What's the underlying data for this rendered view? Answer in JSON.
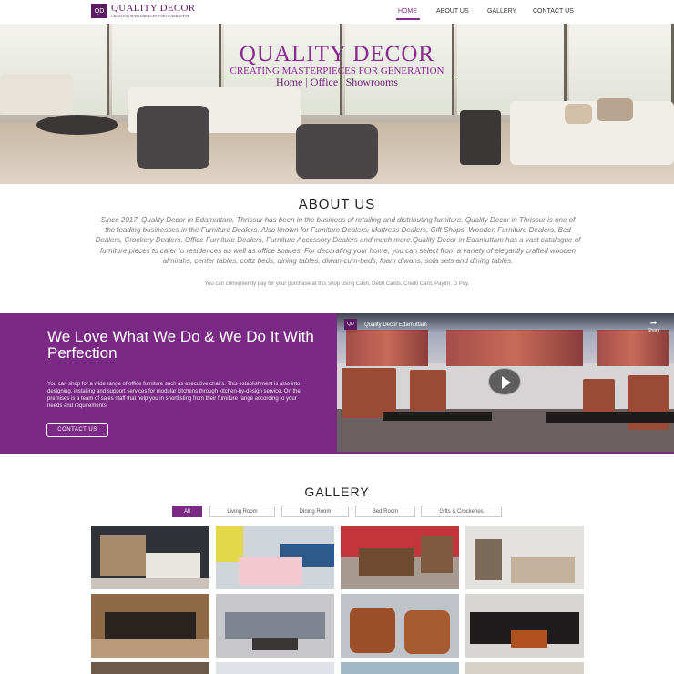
{
  "header": {
    "logo_mark": "QD",
    "logo_name": "QUALITY DECOR",
    "logo_tagline": "CREATING MASTERPIECES FOR GENERATION",
    "nav": [
      "HOME",
      "ABOUT US",
      "GALLERY",
      "CONTACT US"
    ]
  },
  "hero": {
    "title": "QUALITY DECOR",
    "subtitle": "CREATING MASTERPIECES FOR GENERATION",
    "links": "Home | Office | Showrooms"
  },
  "about": {
    "title": "ABOUT US",
    "body": "Since 2017, Quality Decor in Edamuttam, Thrissur has been in the business of retailing and distributing furniture. Quality Decor in Thrissur is one of the leading businesses in the Furniture Dealers. Also known for Furniture Dealers, Mattress Dealers, Gift Shops, Wooden Furniture Dealers, Bed Dealers, Crockery Dealers, Office Furniture Dealers, Furniture Accessory Dealers and much more.Quality Decor in Edamuttam has a vast catalogue of furniture pieces to cater to residences as well as office spaces. For decorating your home, you can select from a variety of elegantly crafted wooden almirahs, center tables, cottz beds, dining tables, diwan-cum-beds, foam diwans, sofa sets and dining tables.",
    "payment": "You can conveniently pay for your purchase at this shop using Cash, Debit Cards, Credit Card, Paytm, G Pay."
  },
  "love": {
    "title": "We Love What We Do & We Do It With Perfection",
    "body": "You can shop for a wide range of office furniture such as executive chairs. This establishment is also into designing, installing and support services for modular kitchens through kitchen-by-design service. On the premises is a team of sales staff that help you in shortlisting from their furniture range according to your needs and requirements.",
    "button": "CONTACT US"
  },
  "video": {
    "channel_mark": "QD",
    "title": "Quality Decor Edamuttam",
    "share_label": "Share"
  },
  "gallery": {
    "title": "GALLERY",
    "filters": [
      "All",
      "Living Room",
      "Dining Room",
      "Bed Room",
      "Gifts & Crockeries"
    ]
  },
  "colors": {
    "brand_purple": "#7a2a84",
    "logo_purple": "#5e1a63"
  }
}
